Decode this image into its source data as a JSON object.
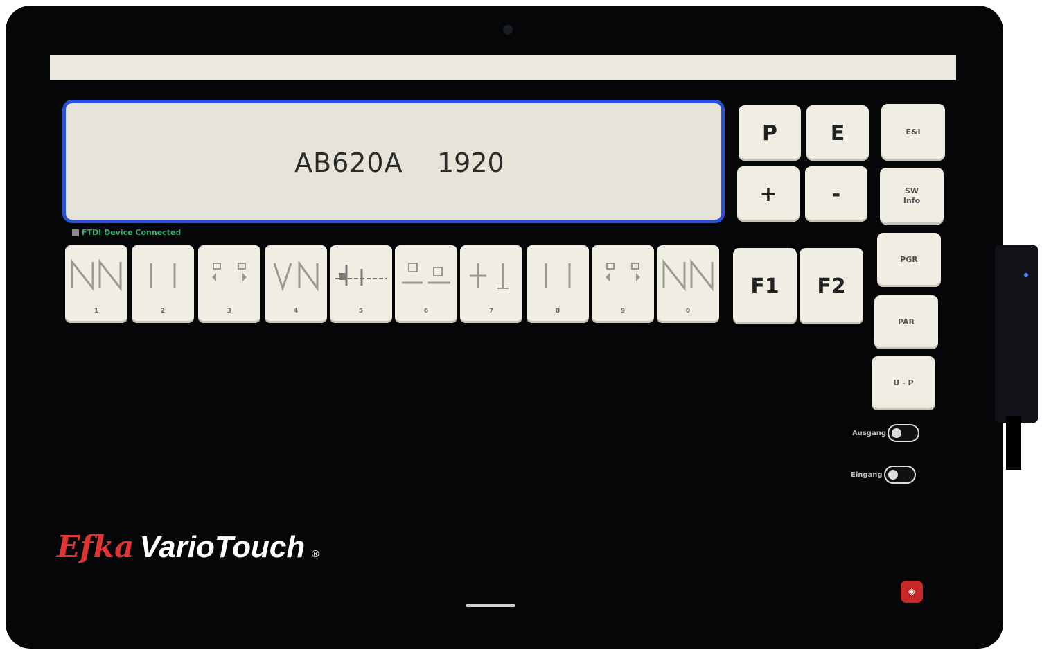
{
  "display": {
    "program_code": "AB620A",
    "value": "1920"
  },
  "status": {
    "text": "FTDI Device Connected"
  },
  "keys": {
    "p": "P",
    "e": "E",
    "plus": "+",
    "minus": "-",
    "f1": "F1",
    "f2": "F2",
    "side_top": "E&I",
    "side_2_line1": "SW",
    "side_2_line2": "Info",
    "side_3": "PGR",
    "side_4": "PAR",
    "side_5": "U - P"
  },
  "stitch_keys": [
    {
      "label": "1",
      "icon": "zigzag-stitch-icon"
    },
    {
      "label": "2",
      "icon": "straight-bars-icon"
    },
    {
      "label": "3",
      "icon": "presser-foot-arrows-icon"
    },
    {
      "label": "4",
      "icon": "reverse-zigzag-icon"
    },
    {
      "label": "5",
      "icon": "bartack-icon"
    },
    {
      "label": "6",
      "icon": "thread-trim-icon"
    },
    {
      "label": "7",
      "icon": "needle-position-icon"
    },
    {
      "label": "8",
      "icon": "straight-bars-icon"
    },
    {
      "label": "9",
      "icon": "presser-foot-arrows-icon"
    },
    {
      "label": "0",
      "icon": "zigzag-stitch-icon"
    }
  ],
  "toggles": {
    "output_label": "Ausgang",
    "input_label": "Eingang"
  },
  "brand": {
    "maker": "Efka",
    "product": "VarioTouch",
    "registered": "®"
  },
  "colors": {
    "display_border": "#2a52d8",
    "key_face": "#f0ede2",
    "status_text": "#33a86d",
    "brand_red": "#e03434"
  }
}
